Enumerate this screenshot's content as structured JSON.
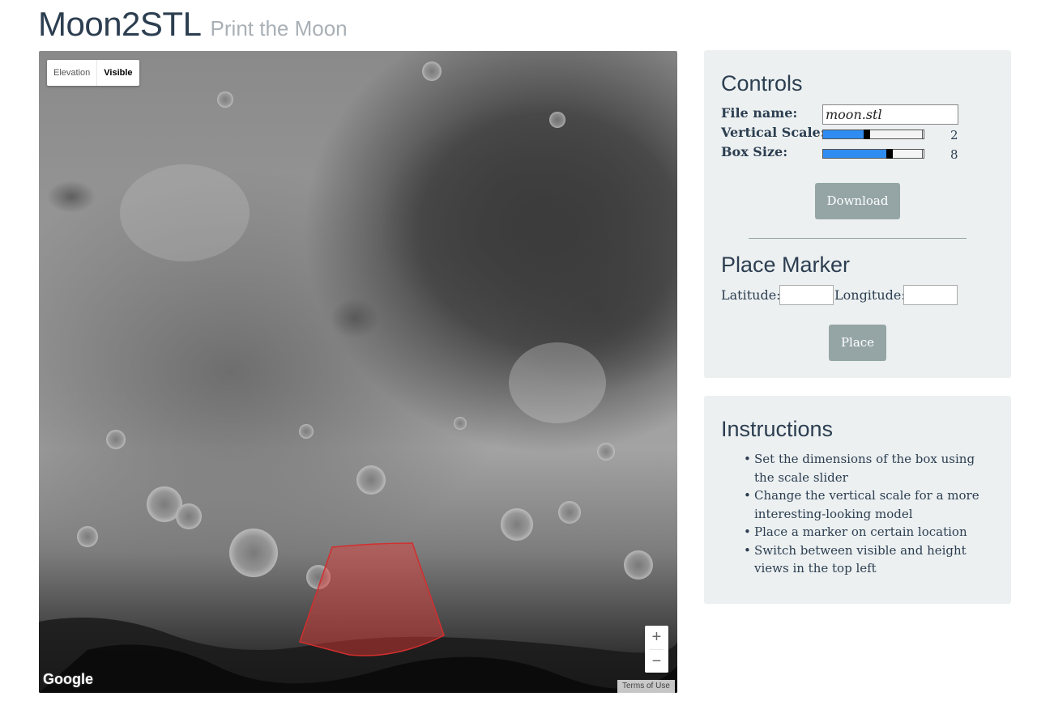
{
  "app": {
    "title": "Moon2STL",
    "subtitle": "Print the Moon"
  },
  "map": {
    "map_types": [
      "Elevation",
      "Visible"
    ],
    "active_map_type": "Visible",
    "zoom_in": "+",
    "zoom_out": "−",
    "attribution": "Google",
    "terms": "Terms of Use",
    "selection_color": "#e53935"
  },
  "controls": {
    "heading": "Controls",
    "file_name_label": "File name:",
    "file_name_value": "moon.stl",
    "vertical_scale_label": "Vertical Scale:",
    "vertical_scale_value": "2",
    "vertical_scale_fraction": 0.4,
    "box_size_label": "Box Size:",
    "box_size_value": "8",
    "box_size_fraction": 0.63,
    "download_label": "Download",
    "accent_color": "#2f8cf0"
  },
  "place_marker": {
    "heading": "Place Marker",
    "latitude_label": "Latitude:",
    "latitude_value": "",
    "longitude_label": "Longitude:",
    "longitude_value": "",
    "place_label": "Place"
  },
  "instructions": {
    "heading": "Instructions",
    "items": [
      "Set the dimensions of the box using the scale slider",
      "Change the vertical scale for a more interesting-looking model",
      "Place a marker on certain location",
      "Switch between visible and height views in the top left"
    ]
  }
}
